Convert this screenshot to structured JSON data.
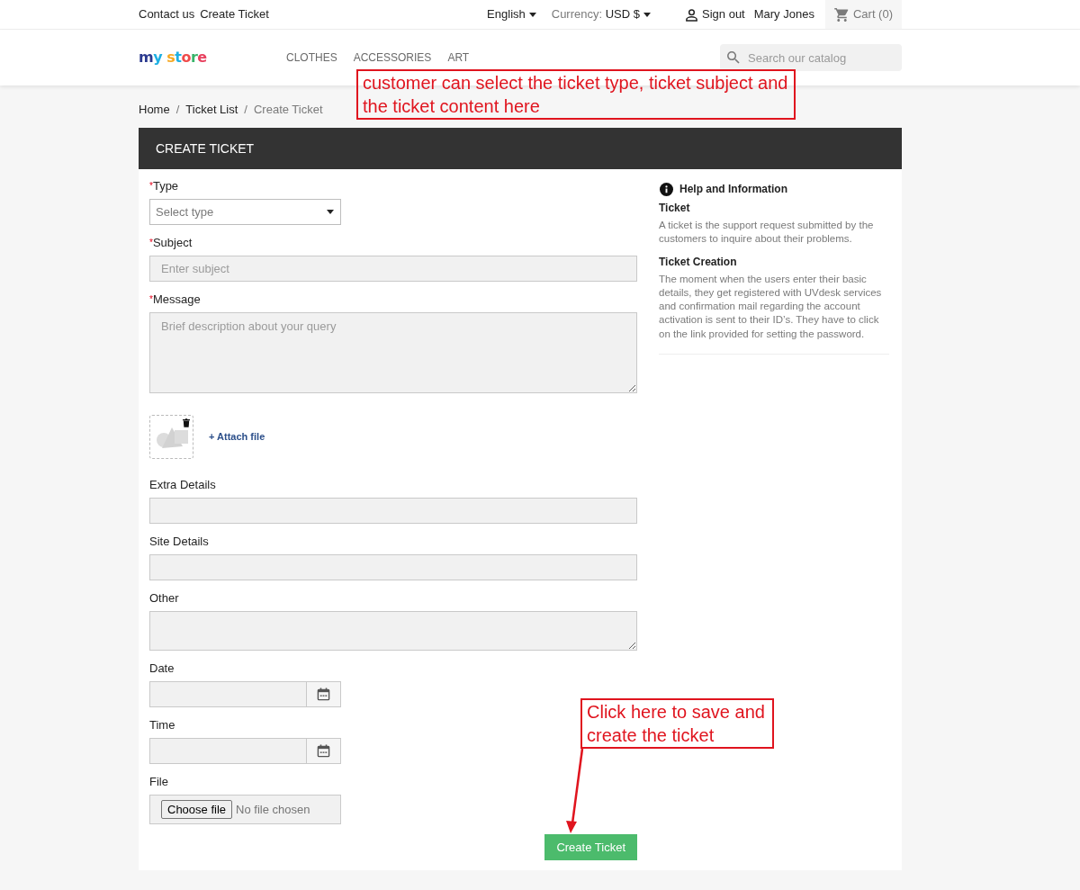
{
  "top_bar": {
    "links": [
      "Contact us",
      "Create Ticket"
    ],
    "language": "English",
    "currency_label": "Currency:",
    "currency": "USD $",
    "sign_out": "Sign out",
    "user_name": "Mary Jones",
    "cart": "Cart (0)"
  },
  "header": {
    "logo": "my store",
    "nav": [
      "CLOTHES",
      "ACCESSORIES",
      "ART"
    ],
    "search": {
      "placeholder": "Search our catalog"
    }
  },
  "breadcrumb": {
    "separator": "/",
    "items": [
      {
        "label": "Home",
        "current": false
      },
      {
        "label": "Ticket List",
        "current": false
      },
      {
        "label": "Create Ticket",
        "current": true
      }
    ]
  },
  "form": {
    "title": "CREATE TICKET",
    "required_mark": "*",
    "fields": [
      {
        "kind": "select",
        "label": "Type",
        "required": true,
        "placeholder": "Select type"
      },
      {
        "kind": "text",
        "label": "Subject",
        "required": true,
        "placeholder": "Enter subject"
      },
      {
        "kind": "textarea",
        "label": "Message",
        "required": true,
        "placeholder": "Brief description about your query"
      },
      {
        "kind": "attachment",
        "link": "+ Attach file"
      },
      {
        "kind": "text",
        "label": "Extra Details",
        "required": false
      },
      {
        "kind": "text",
        "label": "Site Details",
        "required": false
      },
      {
        "kind": "textarea",
        "label": "Other",
        "required": false
      },
      {
        "kind": "picker",
        "label": "Date",
        "required": false
      },
      {
        "kind": "picker",
        "label": "Time",
        "required": false
      },
      {
        "kind": "file",
        "label": "File",
        "required": false,
        "button": "Choose file",
        "status": "No file chosen"
      }
    ],
    "submit": "Create Ticket"
  },
  "help": {
    "title": "Help and Information",
    "sections": [
      {
        "heading": "Ticket",
        "text": "A ticket is the support request submitted by the customers to inquire about their problems."
      },
      {
        "heading": "Ticket Creation",
        "text": "The moment when the users enter their basic details, they get registered with UVdesk services and confirmation mail regarding the account activation is sent to their ID’s. They have to click on the link provided for setting the password."
      }
    ]
  },
  "annotations": [
    {
      "kind": "callout",
      "text": "customer can select the ticket type, ticket subject and the ticket content here"
    },
    {
      "kind": "arrow_callout",
      "text": "Click here to save and create the ticket"
    }
  ]
}
